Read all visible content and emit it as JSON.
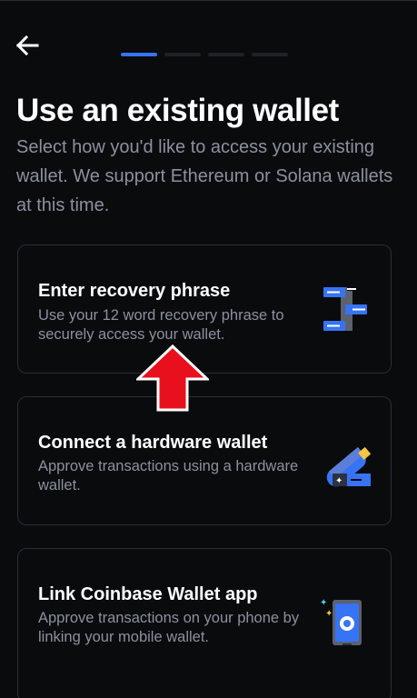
{
  "header": {
    "back_icon": "arrow-left-icon",
    "progress": {
      "current_step": 1,
      "total_steps": 4
    }
  },
  "page": {
    "title": "Use an existing wallet",
    "subtitle": "Select how you'd like to access your existing wallet. We support Ethereum or Solana wallets at this time."
  },
  "options": [
    {
      "title": "Enter recovery phrase",
      "description": "Use your 12 word recovery phrase to securely access your wallet.",
      "icon": "recovery-phrase-icon"
    },
    {
      "title": "Connect a hardware wallet",
      "description": "Approve transactions using a hardware wallet.",
      "icon": "hardware-wallet-icon"
    },
    {
      "title": "Link Coinbase Wallet app",
      "description": "Approve transactions on your phone by linking your mobile wallet.",
      "icon": "mobile-wallet-icon"
    }
  ],
  "annotation": {
    "icon": "red-up-arrow-icon",
    "color": "#e8101c"
  },
  "colors": {
    "background": "#0a0b0d",
    "accent": "#3773f5",
    "muted_text": "#8a919e",
    "card_border": "#2a2d33"
  }
}
